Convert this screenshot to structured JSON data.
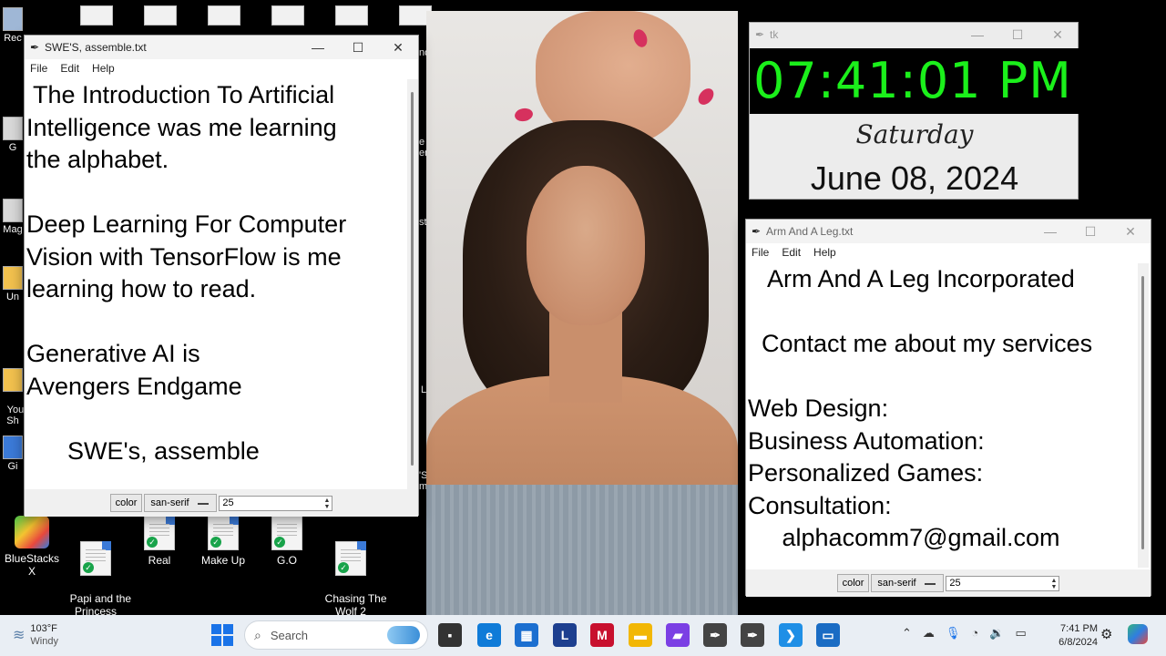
{
  "desktop": {
    "top_left_label": "Rec",
    "left_labels": [
      "G",
      "Mag",
      "Un",
      "You\nSh",
      "Gi"
    ],
    "right_labels": [
      "nd A",
      "e\nerer",
      "st",
      "Life!",
      "'S,\nmble"
    ],
    "icons": [
      {
        "label": "BlueStacks X"
      },
      {
        "label": "Papi and the\nPrincess"
      },
      {
        "label": "Real"
      },
      {
        "label": "Make Up"
      },
      {
        "label": "G.O"
      },
      {
        "label": "Chasing The\nWolf 2"
      }
    ]
  },
  "editor1": {
    "title": "SWE'S, assemble.txt",
    "menu": [
      "File",
      "Edit",
      "Help"
    ],
    "text": " The Introduction To Artificial\nIntelligence was me learning\nthe alphabet.\n\nDeep Learning For Computer\nVision with TensorFlow is me\nlearning how to read.\n\nGenerative AI is\nAvengers Endgame\n\n      SWE's, assemble",
    "color_btn": "color",
    "font": "san-serif",
    "size": "25"
  },
  "clock": {
    "title": "tk",
    "time": "07:41:01 PM",
    "day": "Saturday",
    "date": "June 08, 2024",
    "time_color": "#1bf01b"
  },
  "editor2": {
    "title": "Arm And A Leg.txt",
    "menu": [
      "File",
      "Edit",
      "Help"
    ],
    "text": "   Arm And A Leg Incorporated\n\n  Contact me about my services\n\nWeb Design:\nBusiness Automation:\nPersonalized Games:\nConsultation:\n     alphacomm7@gmail.com",
    "color_btn": "color",
    "font": "san-serif",
    "size": "25"
  },
  "taskbar": {
    "weather_temp": "103°F",
    "weather_desc": "Windy",
    "search_placeholder": "Search",
    "time": "7:41 PM",
    "date": "6/8/2024",
    "apps": [
      {
        "name": "task-view",
        "glyph": "▪",
        "color": "#333333"
      },
      {
        "name": "edge",
        "glyph": "e",
        "color": "#0f7bd8"
      },
      {
        "name": "store",
        "glyph": "▦",
        "color": "#1c6fd0"
      },
      {
        "name": "l-app",
        "glyph": "L",
        "color": "#1d3f8f"
      },
      {
        "name": "mcafee",
        "glyph": "M",
        "color": "#c8102e"
      },
      {
        "name": "file-explorer",
        "glyph": "▬",
        "color": "#f2b705"
      },
      {
        "name": "clipchamp",
        "glyph": "▰",
        "color": "#7b3fe4"
      },
      {
        "name": "feather-1",
        "glyph": "✒",
        "color": "#444444"
      },
      {
        "name": "feather-2",
        "glyph": "✒",
        "color": "#444444"
      },
      {
        "name": "vscode",
        "glyph": "❯",
        "color": "#1f8fe6"
      },
      {
        "name": "terminal",
        "glyph": "▭",
        "color": "#1a6cc4"
      }
    ]
  }
}
